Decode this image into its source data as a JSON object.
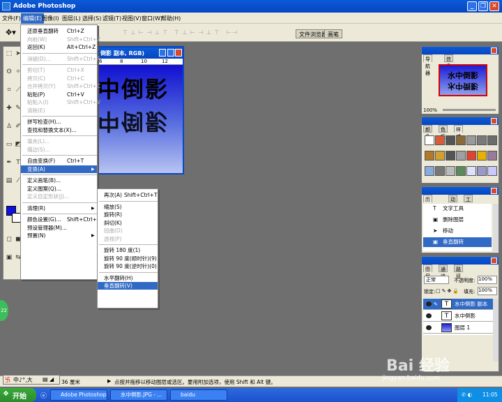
{
  "app": {
    "title": "Adobe Photoshop"
  },
  "menubar": [
    "文件(F)",
    "编辑(E)",
    "图像(I)",
    "图层(L)",
    "选择(S)",
    "滤镜(T)",
    "视图(V)",
    "窗口(W)",
    "帮助(H)"
  ],
  "options": {
    "palette_wells": [
      "文件浏览器",
      "画笔"
    ]
  },
  "document": {
    "title": "倒影 副本, RGB)",
    "ruler_ticks": [
      "6",
      "8",
      "10",
      "12"
    ],
    "text": "水中倒影"
  },
  "edit_menu": [
    {
      "label": "还原垂直翻转",
      "shortcut": "Ctrl+Z",
      "enabled": true
    },
    {
      "label": "向前(W)",
      "shortcut": "Shift+Ctrl+Z",
      "enabled": false
    },
    {
      "label": "返回(K)",
      "shortcut": "Alt+Ctrl+Z",
      "enabled": true
    },
    {
      "sep": true
    },
    {
      "label": "消褪(D)...",
      "shortcut": "Shift+Ctrl+F",
      "enabled": false
    },
    {
      "sep": true
    },
    {
      "label": "剪切(T)",
      "shortcut": "Ctrl+X",
      "enabled": false
    },
    {
      "label": "拷贝(C)",
      "shortcut": "Ctrl+C",
      "enabled": false
    },
    {
      "label": "合并拷贝(Y)",
      "shortcut": "Shift+Ctrl+C",
      "enabled": false
    },
    {
      "label": "粘贴(P)",
      "shortcut": "Ctrl+V",
      "enabled": true
    },
    {
      "label": "粘贴入(I)",
      "shortcut": "Shift+Ctrl+V",
      "enabled": false
    },
    {
      "label": "清除(E)",
      "shortcut": "",
      "enabled": false
    },
    {
      "sep": true
    },
    {
      "label": "拼写检查(H)...",
      "shortcut": "",
      "enabled": true
    },
    {
      "label": "查找和替换文本(X)...",
      "shortcut": "",
      "enabled": true
    },
    {
      "sep": true
    },
    {
      "label": "填充(L)...",
      "shortcut": "",
      "enabled": false
    },
    {
      "label": "描边(S)...",
      "shortcut": "",
      "enabled": false
    },
    {
      "sep": true
    },
    {
      "label": "自由变换(F)",
      "shortcut": "Ctrl+T",
      "enabled": true
    },
    {
      "label": "变换(A)",
      "shortcut": "",
      "enabled": true,
      "highlight": true,
      "submenu": true
    },
    {
      "sep": true
    },
    {
      "label": "定义画笔(B)...",
      "shortcut": "",
      "enabled": true
    },
    {
      "label": "定义图案(Q)...",
      "shortcut": "",
      "enabled": true
    },
    {
      "label": "定义自定形状(J)...",
      "shortcut": "",
      "enabled": false
    },
    {
      "sep": true
    },
    {
      "label": "清理(R)",
      "shortcut": "",
      "enabled": true,
      "submenu": true
    },
    {
      "sep": true
    },
    {
      "label": "颜色设置(G)...",
      "shortcut": "Shift+Ctrl+K",
      "enabled": true
    },
    {
      "label": "预设管理器(M)...",
      "shortcut": "",
      "enabled": true
    },
    {
      "label": "预置(N)",
      "shortcut": "",
      "enabled": true,
      "submenu": true
    }
  ],
  "transform_menu": [
    {
      "label": "再次(A)",
      "shortcut": "Shift+Ctrl+T",
      "enabled": true
    },
    {
      "sep": true
    },
    {
      "label": "缩放(S)",
      "enabled": true
    },
    {
      "label": "旋转(R)",
      "enabled": true
    },
    {
      "label": "斜切(K)",
      "enabled": true
    },
    {
      "label": "扭曲(D)",
      "enabled": false
    },
    {
      "label": "透视(P)",
      "enabled": false
    },
    {
      "sep": true
    },
    {
      "label": "旋转 180 度(1)",
      "enabled": true
    },
    {
      "label": "旋转 90 度(顺时针)(9)",
      "enabled": true
    },
    {
      "label": "旋转 90 度(逆时针)(0)",
      "enabled": true
    },
    {
      "sep": true
    },
    {
      "label": "水平翻转(H)",
      "enabled": true
    },
    {
      "label": "垂直翻转(V)",
      "enabled": true,
      "highlight": true
    }
  ],
  "navigator": {
    "tabs": [
      "导航器",
      "信息"
    ],
    "zoom": "100%",
    "thumb_text": "水中倒影"
  },
  "color_panel": {
    "tabs": [
      "颜色",
      "色板",
      "样式"
    ]
  },
  "history": {
    "tabs": [
      "历史记录",
      "动作",
      "工具预设"
    ],
    "items": [
      "文字工具",
      "删除图层",
      "移动",
      "垂直翻转"
    ]
  },
  "layers": {
    "tabs": [
      "图层",
      "通道",
      "路径"
    ],
    "blend_mode": "正常",
    "opacity_label": "不透明度:",
    "opacity": "100%",
    "lock_label": "锁定:",
    "fill_label": "填充:",
    "fill": "100%",
    "items": [
      {
        "name": "水中倒影 副本",
        "type": "T",
        "selected": true
      },
      {
        "name": "水中倒影",
        "type": "T",
        "selected": false
      },
      {
        "name": "图层 1",
        "type": "img",
        "selected": false
      }
    ]
  },
  "status": {
    "size": "36 厘米",
    "hint": "点按并拖移以移动图层或选区。要用附加选项，使用 Shift 和 Alt 键。"
  },
  "ime": "中♪°,大",
  "taskbar": {
    "start": "开始",
    "tasks": [
      "Adobe Photoshop",
      "水中倒影.JPG - ...",
      "baidu"
    ],
    "clock": "11:05"
  },
  "watermark": {
    "main": "Bai 经验",
    "url": "jingyan.baidu.com"
  },
  "floating_badge": "22"
}
